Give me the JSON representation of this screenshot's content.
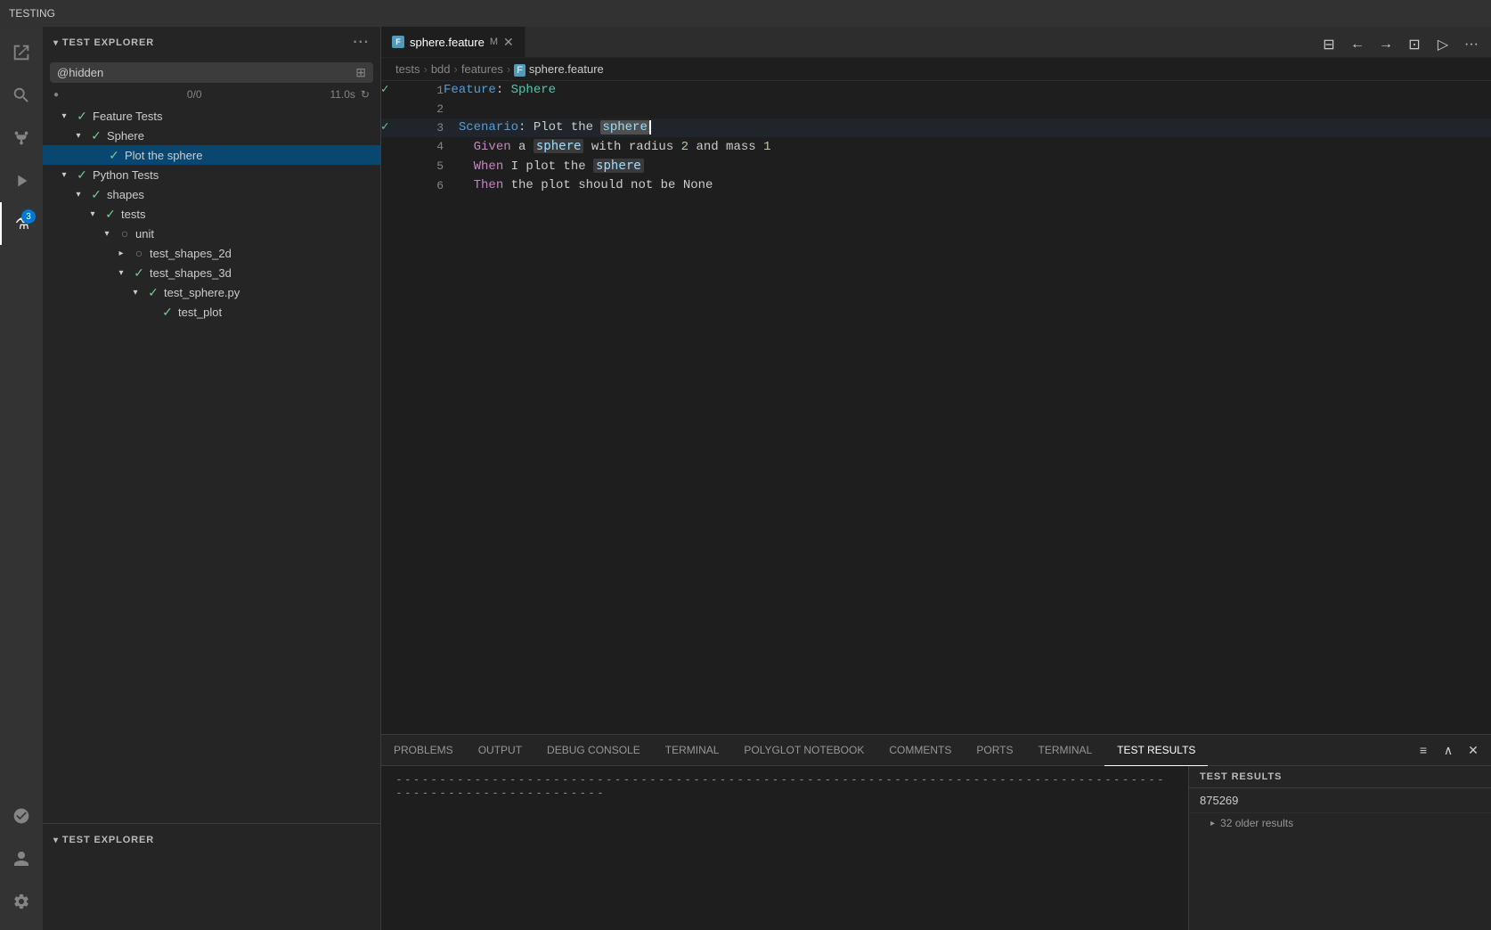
{
  "titleBar": {
    "title": "TESTING"
  },
  "activityBar": {
    "icons": [
      {
        "name": "explorer-icon",
        "symbol": "⎘",
        "active": false
      },
      {
        "name": "search-icon",
        "symbol": "🔍",
        "active": false
      },
      {
        "name": "source-control-icon",
        "symbol": "⎇",
        "active": false
      },
      {
        "name": "run-icon",
        "symbol": "▷",
        "active": false
      },
      {
        "name": "extensions-icon",
        "symbol": "⧉",
        "active": false
      },
      {
        "name": "testing-icon",
        "symbol": "⚗",
        "active": true,
        "badge": "3"
      }
    ],
    "bottomIcons": [
      {
        "name": "remote-icon",
        "symbol": "⚙"
      },
      {
        "name": "account-icon",
        "symbol": "👤"
      },
      {
        "name": "settings-icon",
        "symbol": "⚙"
      }
    ]
  },
  "sidebar": {
    "title": "TEST EXPLORER",
    "searchPlaceholder": "@hidden",
    "stats": {
      "passed": "0/0",
      "time": "11.0s"
    },
    "tree": {
      "items": [
        {
          "id": "feature-tests",
          "label": "Feature Tests",
          "level": 0,
          "expanded": true,
          "status": "pass",
          "chevron": "expanded"
        },
        {
          "id": "sphere",
          "label": "Sphere",
          "level": 1,
          "expanded": true,
          "status": "pass",
          "chevron": "expanded"
        },
        {
          "id": "plot-the-sphere",
          "label": "Plot the sphere",
          "level": 2,
          "expanded": false,
          "status": "pass",
          "chevron": "leaf",
          "selected": true,
          "hasActions": true
        },
        {
          "id": "python-tests",
          "label": "Python Tests",
          "level": 0,
          "expanded": true,
          "status": "pass",
          "chevron": "expanded"
        },
        {
          "id": "shapes",
          "label": "shapes",
          "level": 1,
          "expanded": true,
          "status": "pass",
          "chevron": "expanded"
        },
        {
          "id": "tests",
          "label": "tests",
          "level": 2,
          "expanded": true,
          "status": "pass",
          "chevron": "expanded"
        },
        {
          "id": "unit",
          "label": "unit",
          "level": 3,
          "expanded": true,
          "status": "pending",
          "chevron": "expanded"
        },
        {
          "id": "test_shapes_2d",
          "label": "test_shapes_2d",
          "level": 4,
          "expanded": false,
          "status": "pending",
          "chevron": "collapsed"
        },
        {
          "id": "test_shapes_3d",
          "label": "test_shapes_3d",
          "level": 4,
          "expanded": true,
          "status": "pass",
          "chevron": "expanded"
        },
        {
          "id": "test_sphere_py",
          "label": "test_sphere.py",
          "level": 5,
          "expanded": true,
          "status": "pass",
          "chevron": "expanded"
        },
        {
          "id": "test_plot",
          "label": "test_plot",
          "level": 6,
          "expanded": false,
          "status": "pass",
          "chevron": "leaf"
        }
      ]
    },
    "bottomSection": {
      "title": "TEST EXPLORER"
    }
  },
  "editor": {
    "tab": {
      "filename": "sphere.feature",
      "modifier": "M",
      "icon": "feature"
    },
    "breadcrumb": [
      "tests",
      "bdd",
      "features",
      "sphere.feature"
    ],
    "code": {
      "lines": [
        {
          "num": 1,
          "status": "pass",
          "tokens": [
            {
              "text": "Feature",
              "class": "kw-feature"
            },
            {
              "text": ": ",
              "class": "kw-step"
            },
            {
              "text": "Sphere",
              "class": "kw-name"
            }
          ]
        },
        {
          "num": 2,
          "status": "",
          "tokens": []
        },
        {
          "num": 3,
          "status": "pass",
          "tokens": [
            {
              "text": "  Scenario",
              "class": "kw-scenario"
            },
            {
              "text": ": Plot the ",
              "class": "kw-step"
            },
            {
              "text": "sphere",
              "class": "kw-sphere-hl"
            },
            {
              "text": "▎",
              "class": "cursor"
            }
          ],
          "highlighted": true
        },
        {
          "num": 4,
          "status": "",
          "tokens": [
            {
              "text": "    Given",
              "class": "kw-given"
            },
            {
              "text": " a ",
              "class": "kw-step"
            },
            {
              "text": "sphere",
              "class": "kw-code"
            },
            {
              "text": " with radius ",
              "class": "kw-step"
            },
            {
              "text": "2",
              "class": "kw-num"
            },
            {
              "text": " and mass ",
              "class": "kw-step"
            },
            {
              "text": "1",
              "class": "kw-num"
            }
          ]
        },
        {
          "num": 5,
          "status": "",
          "tokens": [
            {
              "text": "    When",
              "class": "kw-when"
            },
            {
              "text": " I plot the ",
              "class": "kw-step"
            },
            {
              "text": "sphere",
              "class": "kw-code"
            }
          ]
        },
        {
          "num": 6,
          "status": "",
          "tokens": [
            {
              "text": "    Then",
              "class": "kw-then"
            },
            {
              "text": " the plot should not be None",
              "class": "kw-step"
            }
          ]
        }
      ]
    }
  },
  "bottomPanel": {
    "tabs": [
      {
        "label": "PROBLEMS",
        "active": false
      },
      {
        "label": "OUTPUT",
        "active": false
      },
      {
        "label": "DEBUG CONSOLE",
        "active": false
      },
      {
        "label": "TERMINAL",
        "active": false
      },
      {
        "label": "POLYGLOT NOTEBOOK",
        "active": false
      },
      {
        "label": "COMMENTS",
        "active": false
      },
      {
        "label": "PORTS",
        "active": false
      },
      {
        "label": "TERMINAL",
        "active": false
      },
      {
        "label": "TEST RESULTS",
        "active": true
      }
    ],
    "content": {
      "dashes": "----------------------------------------------------------------------------------------------------------------"
    },
    "testResults": {
      "header": "TEST RESULTS",
      "resultId": "875269",
      "olderResults": "32 older results"
    }
  }
}
